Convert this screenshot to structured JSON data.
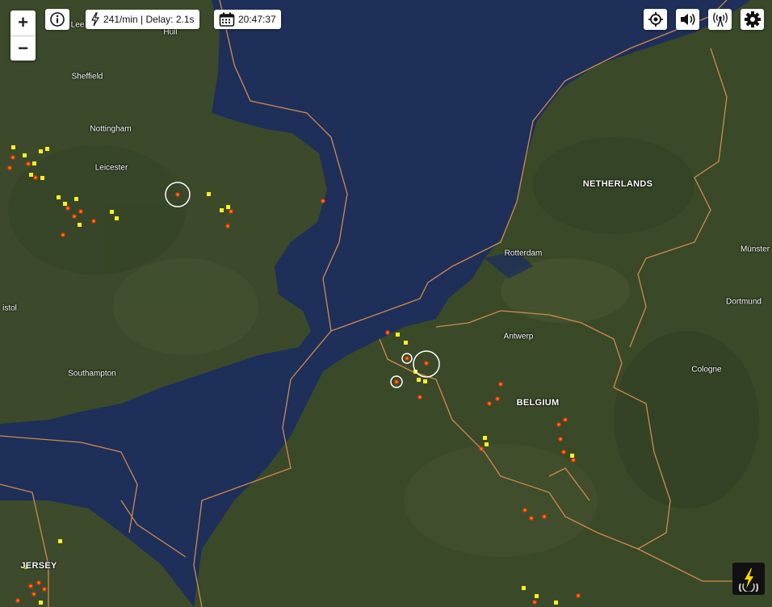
{
  "status": {
    "rate": "241/min | Delay: 2.1s",
    "time": "20:47:37"
  },
  "controls": {
    "zoom_in": "+",
    "zoom_out": "−"
  },
  "icons": {
    "info": "info-icon",
    "lightning": "lightning-icon",
    "calendar": "calendar-icon",
    "locate": "locate-icon",
    "sound": "speaker-icon",
    "stations": "antenna-icon",
    "settings": "gear-icon",
    "logo": "lightning-logo-icon"
  },
  "map": {
    "places": {
      "hull": "Hull",
      "leeds": "Lee",
      "sheffield": "Sheffield",
      "nottingham": "Nottingham",
      "leicester": "Leicester",
      "bristol": "istol",
      "southampton": "Southampton",
      "jersey": "JERSEY",
      "netherlands": "NETHERLANDS",
      "rotterdam": "Rotterdam",
      "antwerp": "Antwerp",
      "belgium": "BELGIUM",
      "munster": "Münster",
      "dortmund": "Dortmund",
      "cologne": "Cologne"
    },
    "colors": {
      "sea": "#1e2f5a",
      "land": "#3b4a2a",
      "border": "#d08a4c",
      "strike_recent": "#ff5a1e",
      "strike_old": "#ffee22"
    }
  }
}
